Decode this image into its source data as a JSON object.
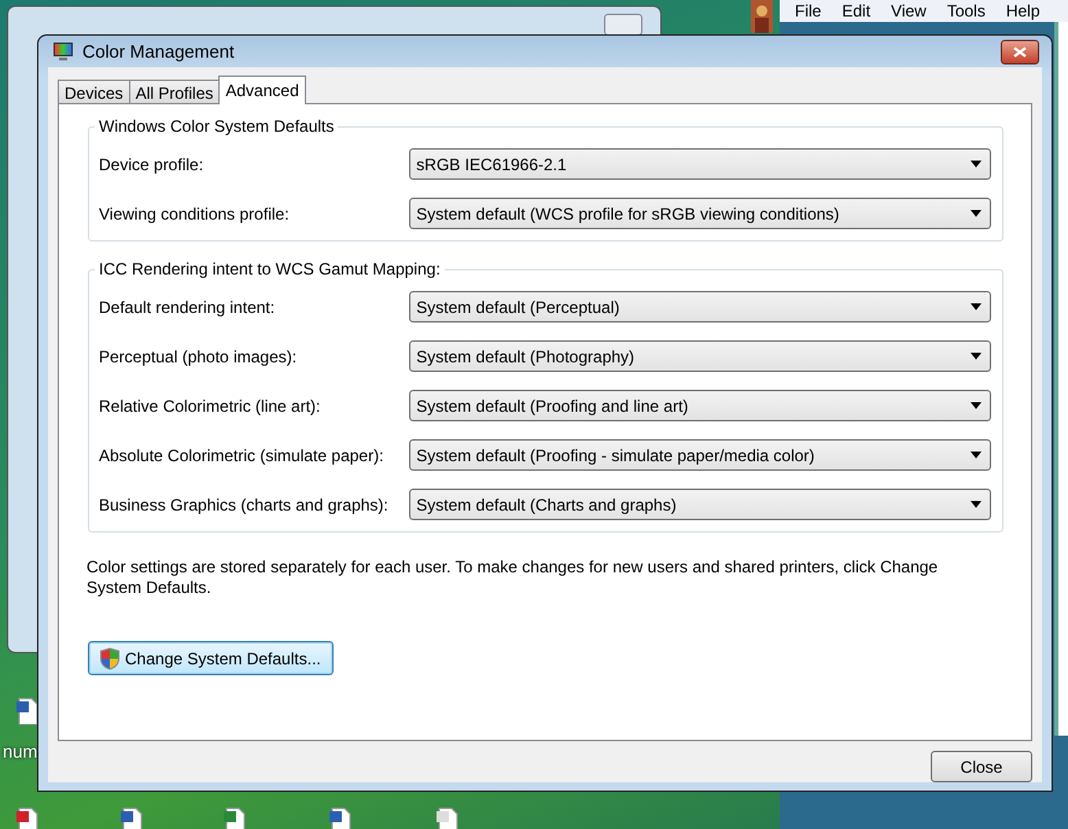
{
  "desktop": {
    "menu_bar": [
      "File",
      "Edit",
      "View",
      "Tools",
      "Help"
    ],
    "icon_label": "num"
  },
  "window": {
    "title": "Color Management",
    "tabs": [
      {
        "label": "Devices",
        "selected": false
      },
      {
        "label": "All Profiles",
        "selected": false
      },
      {
        "label": "Advanced",
        "selected": true
      }
    ],
    "groups": [
      {
        "title": "Windows Color System Defaults",
        "rows": [
          {
            "label": "Device profile:",
            "value": "sRGB IEC61966-2.1"
          },
          {
            "label": "Viewing conditions profile:",
            "value": "System default (WCS profile for sRGB viewing conditions)"
          }
        ]
      },
      {
        "title": "ICC Rendering intent to WCS Gamut Mapping:",
        "rows": [
          {
            "label": "Default rendering intent:",
            "value": "System default (Perceptual)"
          },
          {
            "label": "Perceptual (photo images):",
            "value": "System default (Photography)"
          },
          {
            "label": "Relative Colorimetric (line art):",
            "value": "System default (Proofing and line art)"
          },
          {
            "label": "Absolute Colorimetric (simulate paper):",
            "value": "System default (Proofing - simulate paper/media color)"
          },
          {
            "label": "Business Graphics (charts and graphs):",
            "value": "System default (Charts and graphs)"
          }
        ]
      }
    ],
    "note": "Color settings are stored separately for each user. To make changes for new users and shared printers, click Change System Defaults.",
    "system_button": "Change System Defaults...",
    "close_button": "Close"
  }
}
